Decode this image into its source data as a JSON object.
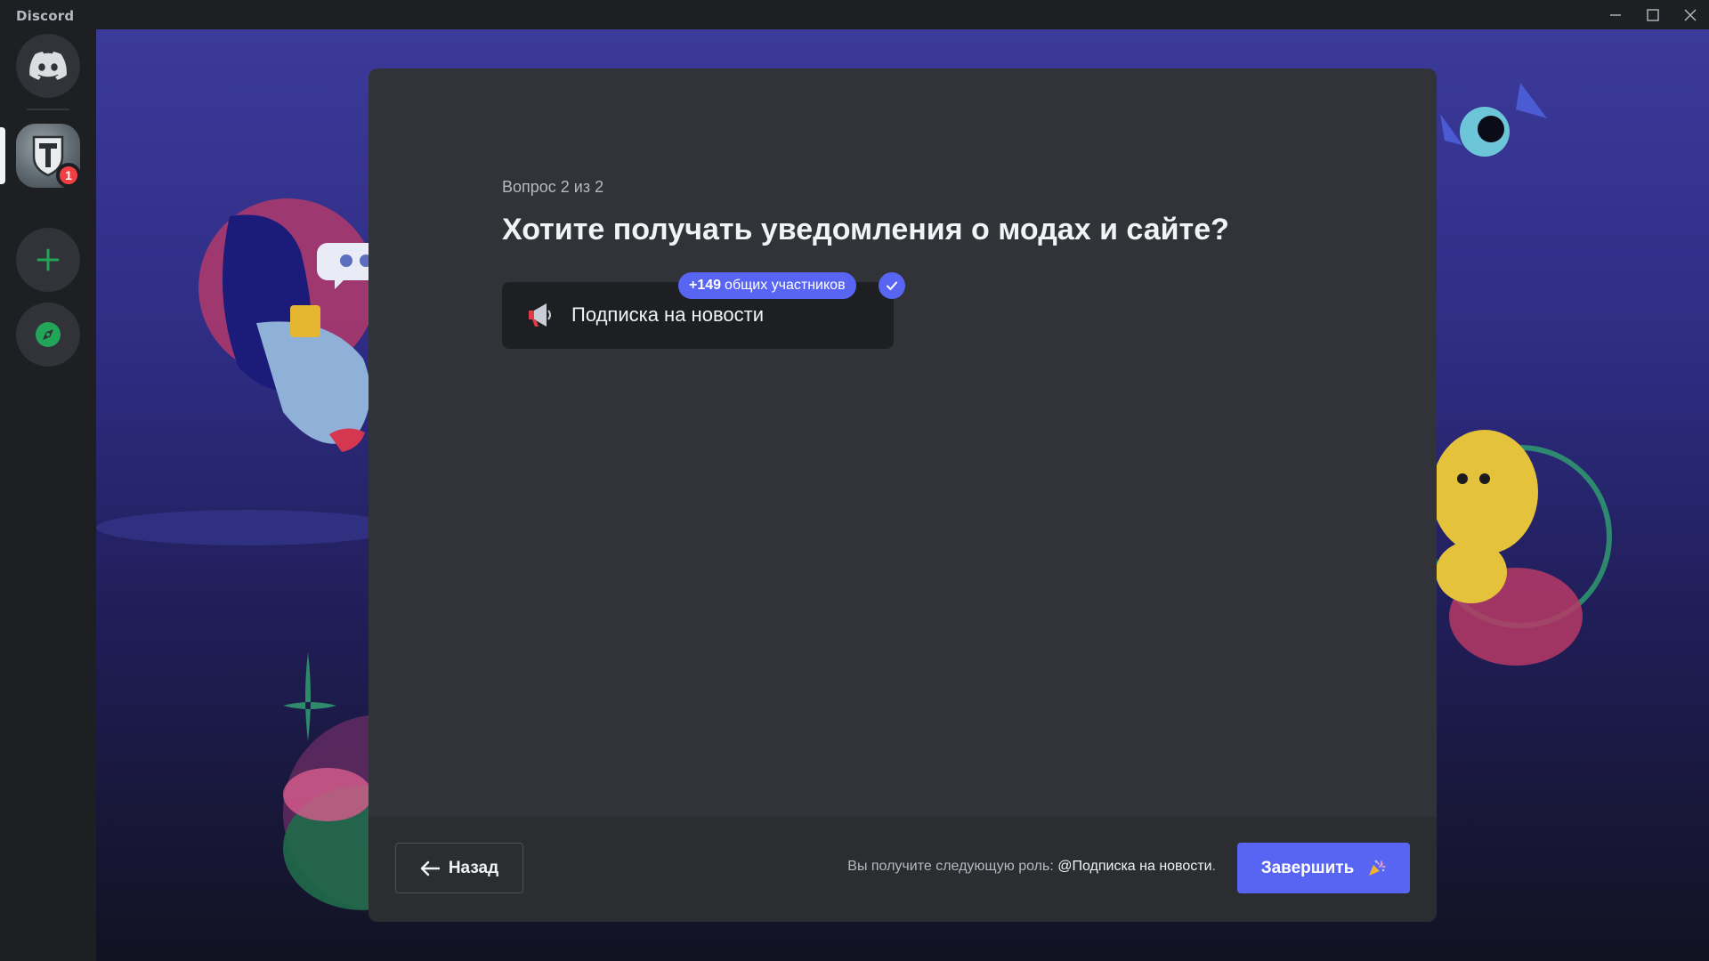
{
  "app": {
    "title": "Discord"
  },
  "window_controls": [
    "minimize-icon",
    "maximize-icon",
    "close-icon"
  ],
  "rail": {
    "home_icon": "discord-logo-icon",
    "servers": [
      {
        "icon": "world-of-tanks-server-icon",
        "unread_badge": "1"
      }
    ],
    "add_server_icon": "plus-icon",
    "discover_icon": "compass-icon"
  },
  "onboarding": {
    "step": "Вопрос 2 из 2",
    "question": "Хотите получать уведомления о модах и сайте?",
    "option": {
      "icon": "megaphone-icon",
      "label": "Подписка на новости",
      "members_count": "+149",
      "members_text": "общих участников",
      "selected": true
    },
    "footer": {
      "back_label": "Назад",
      "role_note_prefix": "Вы получите следующую роль:",
      "role_name": "@Подписка на новости",
      "role_note_suffix": ".",
      "finish_label": "Завершить"
    }
  },
  "colors": {
    "accent": "#5865f2",
    "badge": "#f23f43",
    "modal_bg": "#313338",
    "rail_bg": "#1e1f22"
  }
}
